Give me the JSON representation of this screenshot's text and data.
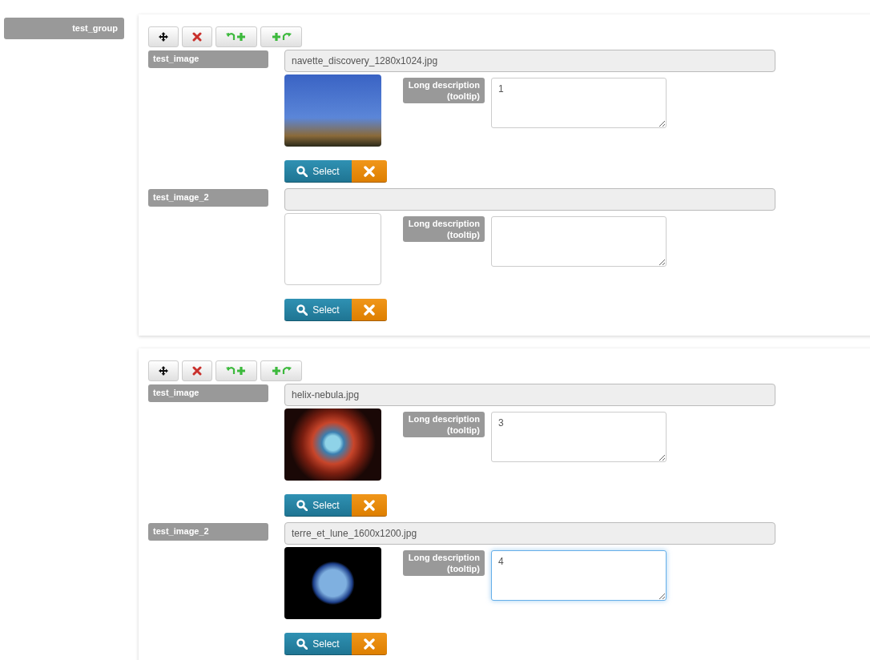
{
  "group": {
    "label": "test_group"
  },
  "items": [
    {
      "fields": [
        {
          "label": "test_image",
          "filename": "navette_discovery_1280x1024.jpg",
          "has_image": true,
          "description_label": "Long description",
          "description_note": "(tooltip)",
          "description": "1",
          "focused": false,
          "select_label": "Select"
        },
        {
          "label": "test_image_2",
          "has_image": false,
          "description_label": "Long description",
          "description_note": "(tooltip)",
          "focused": false,
          "select_label": "Select"
        }
      ]
    },
    {
      "fields": [
        {
          "label": "test_image",
          "filename": "helix-nebula.jpg",
          "has_image": true,
          "description_label": "Long description",
          "description_note": "(tooltip)",
          "description": "3",
          "focused": false,
          "select_label": "Select"
        },
        {
          "label": "test_image_2",
          "filename": "terre_et_lune_1600x1200.jpg",
          "has_image": true,
          "description_label": "Long description",
          "description_note": "(tooltip)",
          "description": "4",
          "focused": true,
          "select_label": "Select"
        }
      ]
    }
  ]
}
